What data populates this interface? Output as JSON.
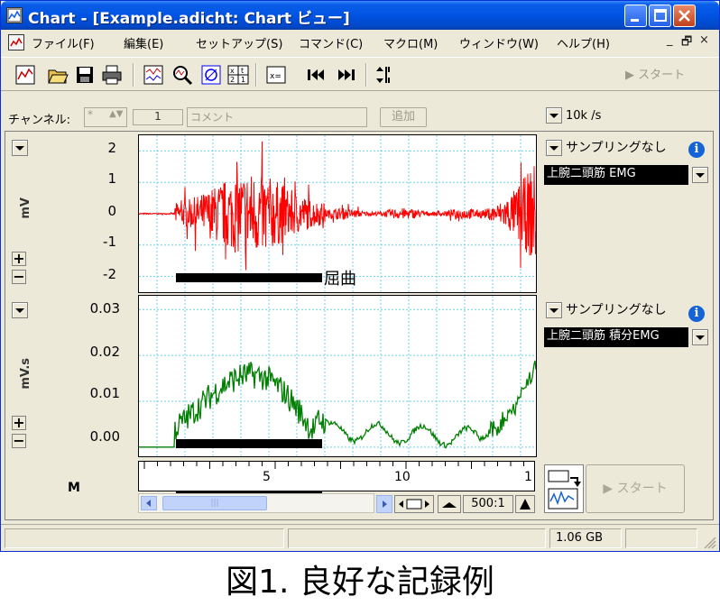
{
  "window": {
    "title": "Chart - [Example.adicht: Chart ビュー]",
    "caption_buttons": [
      "minimize",
      "maximize",
      "close"
    ]
  },
  "menu": {
    "items": [
      "ファイル(F)",
      "編集(E)",
      "セットアップ(S)",
      "コマンド(C)",
      "マクロ(M)",
      "ウィンドウ(W)",
      "ヘルプ(H)"
    ],
    "mdi_controls": [
      "_",
      "🗗",
      "×"
    ]
  },
  "toolbar": {
    "icons": [
      "chart-view-icon",
      "open-icon",
      "save-icon",
      "print-icon",
      "zoom-window-icon",
      "magnify-icon",
      "xy-view-icon",
      "data-pad-icon",
      "comment-icon",
      "go-start-icon",
      "go-end-icon",
      "block-icon"
    ],
    "start_label": "▶ スタート"
  },
  "channel_bar": {
    "channel_label": "チャンネル:",
    "channel_value": "*",
    "channel_number": "1",
    "comment_placeholder": "コメント",
    "add_label": "追加",
    "rate": "10k /s"
  },
  "channels": [
    {
      "title": "上腕二頭筋 EMG",
      "sampling": "サンプリングなし",
      "unit": "mV",
      "ticks": [
        "2",
        "1",
        "0",
        "-1",
        "-2"
      ],
      "trace_color": "#ff0000",
      "range": [
        -2.5,
        2.5
      ]
    },
    {
      "title": "上腕二頭筋 積分EMG",
      "sampling": "サンプリングなし",
      "unit": "mV.s",
      "ticks": [
        "0.03",
        "0.02",
        "0.01",
        "0.00"
      ],
      "trace_color": "#007f00",
      "range": [
        -0.002,
        0.033
      ]
    }
  ],
  "annotation": {
    "flexion_label": "屈曲"
  },
  "time_axis": {
    "ticks": [
      "5",
      "10",
      "1"
    ]
  },
  "bottom_controls": {
    "marker": "M",
    "zoom": "500:1",
    "start_label": "▶ スタート"
  },
  "status": {
    "disk": "1.06 GB"
  },
  "caption": "図1. 良好な記録例"
}
